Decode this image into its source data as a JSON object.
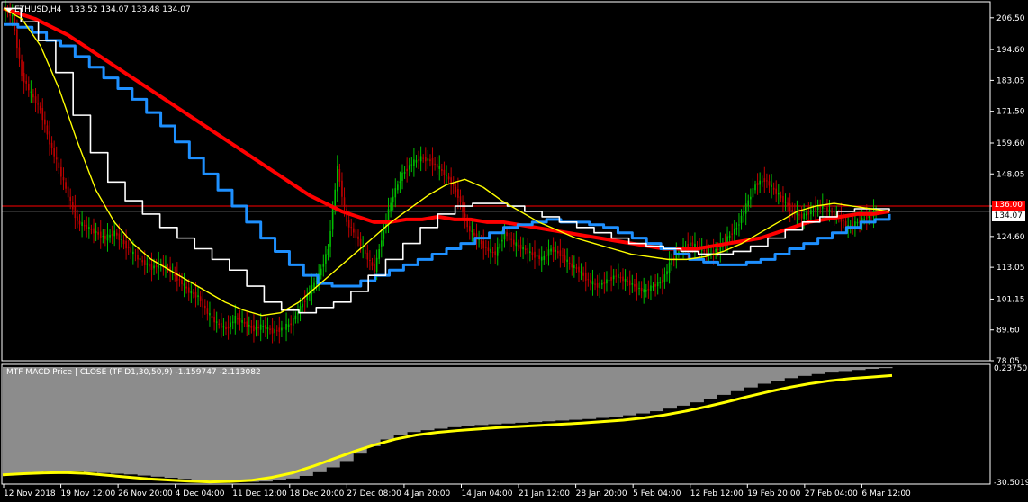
{
  "header": {
    "symbol": "ETHUSD,H4",
    "ohlc": "133.52 134.07 133.48 134.07",
    "indicator": "MTF MACD Price | CLOSE  (TF D1,30,50,9)  -1.159747 -2.113082"
  },
  "colors": {
    "background": "#000000",
    "grid_axis": "#ffffff",
    "bull": "#00c000",
    "bear": "#c00000",
    "ema_slow": "#ff0000",
    "ma_blue": "#1e90ff",
    "ma_white": "#ffffff",
    "ma_yellow": "#ffff00",
    "hist": "#8c8c8c"
  },
  "price_boxes": {
    "red_level": "136.00",
    "last_price": "134.07"
  },
  "chart_data": [
    {
      "type": "line",
      "title": "ETHUSD,H4",
      "ylim": [
        78.05,
        212.5
      ],
      "y_ticks": [
        "206.50",
        "194.60",
        "183.05",
        "171.50",
        "159.60",
        "148.05",
        "136.00",
        "124.60",
        "113.05",
        "101.15",
        "89.60",
        "78.05"
      ],
      "x_labels": [
        "12 Nov 2018",
        "19 Nov 12:00",
        "26 Nov 20:00",
        "4 Dec 04:00",
        "11 Dec 12:00",
        "18 Dec 20:00",
        "27 Dec 08:00",
        "4 Jan 20:00",
        "14 Jan 04:00",
        "21 Jan 12:00",
        "28 Jan 20:00",
        "5 Feb 04:00",
        "12 Feb 12:00",
        "19 Feb 20:00",
        "27 Feb 04:00",
        "6 Mar 12:00"
      ],
      "horizontal_lines": [
        136.0,
        134.07
      ],
      "price_series": [
        210,
        207,
        185,
        178,
        172,
        160,
        150,
        140,
        130,
        128,
        126,
        124,
        126,
        122,
        118,
        115,
        113,
        114,
        112,
        108,
        104,
        102,
        96,
        92,
        90,
        94,
        92,
        90,
        91,
        89,
        90,
        92,
        98,
        104,
        110,
        120,
        150,
        130,
        125,
        118,
        112,
        128,
        140,
        148,
        152,
        154,
        153,
        150,
        146,
        140,
        128,
        124,
        120,
        118,
        126,
        122,
        120,
        118,
        116,
        120,
        118,
        114,
        112,
        108,
        106,
        108,
        110,
        108,
        106,
        104,
        106,
        108,
        116,
        120,
        122,
        120,
        118,
        120,
        124,
        128,
        136,
        144,
        146,
        142,
        138,
        134,
        132,
        134,
        136,
        134,
        132,
        128,
        130,
        132,
        134
      ],
      "series": [
        {
          "name": "",
          "color": "#ff0000",
          "values": [
            210,
            208,
            206,
            203,
            200,
            196,
            192,
            188,
            184,
            180,
            176,
            172,
            168,
            164,
            160,
            156,
            152,
            148,
            144,
            140,
            137,
            134,
            132,
            130,
            130,
            131,
            131,
            132,
            131,
            131,
            130,
            130,
            129,
            128,
            127,
            126,
            125,
            124,
            123,
            122,
            121,
            120,
            120,
            120,
            121,
            122,
            123,
            124,
            126,
            128,
            130,
            131,
            132,
            133,
            133,
            134
          ]
        },
        {
          "name": "",
          "color": "#1e90ff",
          "values": [
            204,
            203,
            201,
            198,
            196,
            192,
            188,
            184,
            180,
            176,
            171,
            166,
            160,
            154,
            148,
            142,
            136,
            130,
            124,
            119,
            114,
            110,
            107,
            106,
            106,
            108,
            110,
            112,
            114,
            116,
            118,
            120,
            122,
            124,
            126,
            128,
            129,
            130,
            131,
            130,
            130,
            129,
            128,
            126,
            124,
            122,
            120,
            118,
            116,
            115,
            114,
            114,
            115,
            116,
            118,
            120,
            122,
            124,
            126,
            128,
            130,
            131,
            133
          ]
        },
        {
          "name": "",
          "color": "#ffffff",
          "values": [
            210,
            205,
            198,
            186,
            170,
            156,
            145,
            138,
            133,
            128,
            124,
            120,
            116,
            112,
            106,
            100,
            97,
            96,
            98,
            100,
            104,
            110,
            116,
            122,
            128,
            133,
            136,
            137,
            137,
            136,
            134,
            132,
            130,
            128,
            126,
            124,
            122,
            121,
            120,
            119,
            118,
            118,
            119,
            121,
            124,
            127,
            130,
            132,
            134,
            135,
            135,
            134
          ]
        },
        {
          "name": "",
          "color": "#ffff00",
          "values": [
            210,
            206,
            196,
            180,
            160,
            142,
            130,
            122,
            116,
            112,
            108,
            104,
            100,
            97,
            95,
            96,
            100,
            106,
            112,
            118,
            124,
            130,
            135,
            140,
            144,
            146,
            143,
            138,
            134,
            130,
            127,
            124,
            122,
            120,
            118,
            117,
            116,
            116,
            117,
            119,
            122,
            126,
            130,
            134,
            136,
            137,
            136,
            135,
            134
          ]
        }
      ]
    },
    {
      "type": "area",
      "title": "MTF MACD Price | CLOSE  (TF D1,30,50,9)",
      "ylim": [
        -30.5019,
        0.237503
      ],
      "y_ticks": [
        "0.237503",
        "-30.5019"
      ],
      "histogram": [
        -28.2,
        -28.0,
        -27.8,
        -27.6,
        -27.5,
        -27.6,
        -27.8,
        -28.0,
        -28.2,
        -28.4,
        -28.7,
        -29.0,
        -29.3,
        -29.6,
        -29.9,
        -30.1,
        -30.3,
        -30.4,
        -30.4,
        -30.3,
        -30.0,
        -29.5,
        -28.8,
        -27.8,
        -26.5,
        -24.8,
        -22.8,
        -20.8,
        -19.0,
        -17.8,
        -17.0,
        -16.5,
        -16.1,
        -15.7,
        -15.4,
        -15.1,
        -14.9,
        -14.7,
        -14.5,
        -14.3,
        -14.1,
        -13.9,
        -13.7,
        -13.5,
        -13.2,
        -12.9,
        -12.5,
        -12.0,
        -11.4,
        -10.7,
        -9.9,
        -9.0,
        -8.0,
        -7.0,
        -6.0,
        -5.0,
        -4.0,
        -3.2,
        -2.5,
        -1.9,
        -1.4,
        -1.0,
        -0.6,
        -0.3,
        0.0,
        0.2
      ],
      "signal": [
        -28.5,
        -28.2,
        -28.0,
        -27.9,
        -28.1,
        -28.6,
        -29.1,
        -29.6,
        -29.9,
        -30.2,
        -30.4,
        -30.3,
        -30.0,
        -29.2,
        -28.0,
        -26.2,
        -24.2,
        -22.2,
        -20.4,
        -18.9,
        -17.8,
        -17.1,
        -16.6,
        -16.2,
        -15.8,
        -15.5,
        -15.2,
        -14.9,
        -14.6,
        -14.2,
        -13.8,
        -13.2,
        -12.4,
        -11.4,
        -10.2,
        -8.9,
        -7.5,
        -6.2,
        -5.0,
        -4.0,
        -3.2,
        -2.6,
        -2.2,
        -1.8
      ]
    }
  ]
}
